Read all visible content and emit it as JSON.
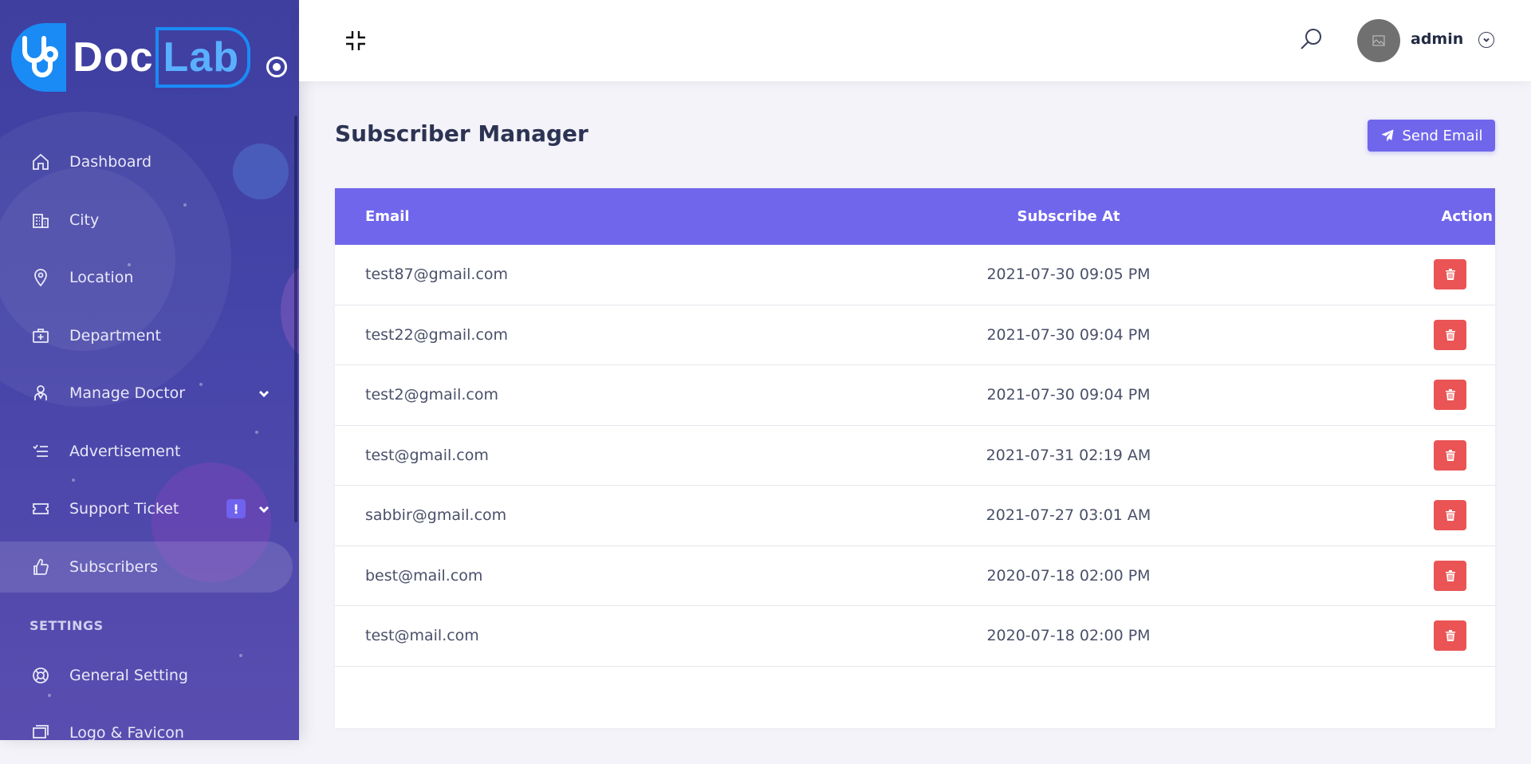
{
  "brand": {
    "doc": "Doc",
    "lab": "Lab"
  },
  "sidebar": {
    "items": [
      {
        "label": "Dashboard",
        "icon": "home-icon"
      },
      {
        "label": "City",
        "icon": "building-icon"
      },
      {
        "label": "Location",
        "icon": "map-pin-icon"
      },
      {
        "label": "Department",
        "icon": "first-aid-kit-icon"
      },
      {
        "label": "Manage Doctor",
        "icon": "doctor-icon",
        "has_submenu": true
      },
      {
        "label": "Advertisement",
        "icon": "list-check-icon"
      },
      {
        "label": "Support Ticket",
        "icon": "ticket-icon",
        "has_submenu": true,
        "badge": "!"
      },
      {
        "label": "Subscribers",
        "icon": "thumbs-up-icon",
        "active": true
      }
    ],
    "section_label": "SETTINGS",
    "settings_items": [
      {
        "label": "General Setting",
        "icon": "lifebuoy-icon"
      },
      {
        "label": "Logo & Favicon",
        "icon": "images-icon"
      }
    ]
  },
  "header": {
    "user_name": "admin"
  },
  "main": {
    "title": "Subscriber Manager",
    "send_email_label": "Send Email",
    "table": {
      "columns": [
        "Email",
        "Subscribe At",
        "Action"
      ],
      "rows": [
        {
          "email": "test87@gmail.com",
          "subscribed_at": "2021-07-30 09:05 PM"
        },
        {
          "email": "test22@gmail.com",
          "subscribed_at": "2021-07-30 09:04 PM"
        },
        {
          "email": "test2@gmail.com",
          "subscribed_at": "2021-07-30 09:04 PM"
        },
        {
          "email": "test@gmail.com",
          "subscribed_at": "2021-07-31 02:19 AM"
        },
        {
          "email": "sabbir@gmail.com",
          "subscribed_at": "2021-07-27 03:01 AM"
        },
        {
          "email": "best@mail.com",
          "subscribed_at": "2020-07-18 02:00 PM"
        },
        {
          "email": "test@mail.com",
          "subscribed_at": "2020-07-18 02:00 PM"
        }
      ]
    }
  },
  "colors": {
    "accent": "#7066ec",
    "danger": "#ea5455",
    "sidebar": "#4444a8"
  }
}
